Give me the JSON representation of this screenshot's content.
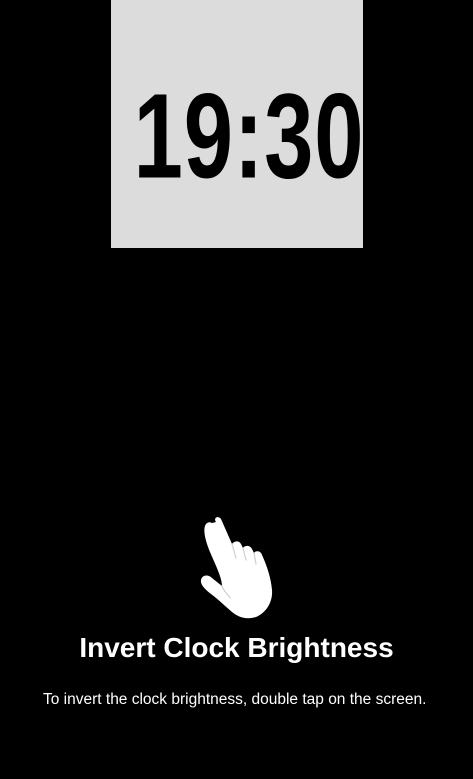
{
  "clock": {
    "time": "19:30"
  },
  "instruction": {
    "icon": "tap-hand-icon",
    "title": "Invert Clock Brightness",
    "description": "To invert the clock brightness, double tap on the screen."
  },
  "colors": {
    "background": "#000000",
    "clock_panel": "#dcdcdc",
    "clock_text": "#000000",
    "text": "#ffffff"
  }
}
